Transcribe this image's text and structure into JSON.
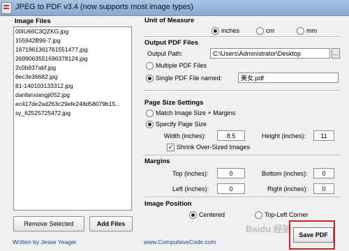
{
  "window": {
    "title": "JPEG to PDF  v3.4    (now supports most image types)"
  },
  "image_files": {
    "heading": "Image Files",
    "files": [
      "00IU66C3QZKG.jpg",
      "155942B96-7.jpg",
      "1671961361761551477.jpg",
      "2699063551696378124.jpg",
      "2c0b937abf.jpg",
      "6ec3e36682.jpg",
      "81-140103133312.jpg",
      "danfanxiangji052.jpg",
      "ec417de2ad263c29efe248d58079b15...",
      "sy_62525725472.jpg"
    ],
    "remove_label": "Remove Selected",
    "add_label": "Add Files"
  },
  "unit": {
    "heading": "Unit of Measure",
    "options": [
      "inches",
      "cm",
      "mm"
    ],
    "selected": "inches"
  },
  "output": {
    "heading": "Output PDF Files",
    "path_label": "Output Path:",
    "path_value": "C:\\Users\\Administrator\\Desktop",
    "browse_label": "...",
    "multiple_label": "Multiple PDF Files",
    "single_label": "Single PDF File named:",
    "single_name": "美女.pdf",
    "selected": "single"
  },
  "page_size": {
    "heading": "Page Size Settings",
    "match_label": "Match Image Size + Margins",
    "specify_label": "Specify Page Size",
    "selected": "specify",
    "width_label": "Width (inches):",
    "width_value": "8.5",
    "height_label": "Height (inches):",
    "height_value": "11",
    "shrink_label": "Shrink Over-Sized Images",
    "shrink_checked": true
  },
  "margins": {
    "heading": "Margins",
    "top_label": "Top (inches):",
    "top_value": "0",
    "bottom_label": "Bottom (inches):",
    "bottom_value": "0",
    "left_label": "Left (inches):",
    "left_value": "0",
    "right_label": "Right (inches):",
    "right_value": "0"
  },
  "position": {
    "heading": "Image Position",
    "centered_label": "Centered",
    "topleft_label": "Top-Left Corner",
    "selected": "centered"
  },
  "footer": {
    "author": "Written by Jesse Yeager",
    "website": "www.CompulsiveCode.com",
    "save_label": "Save PDF"
  },
  "watermark": "Baidu 经验",
  "colors": {
    "link": "#1a3ea8",
    "highlight": "#d81e1e"
  }
}
